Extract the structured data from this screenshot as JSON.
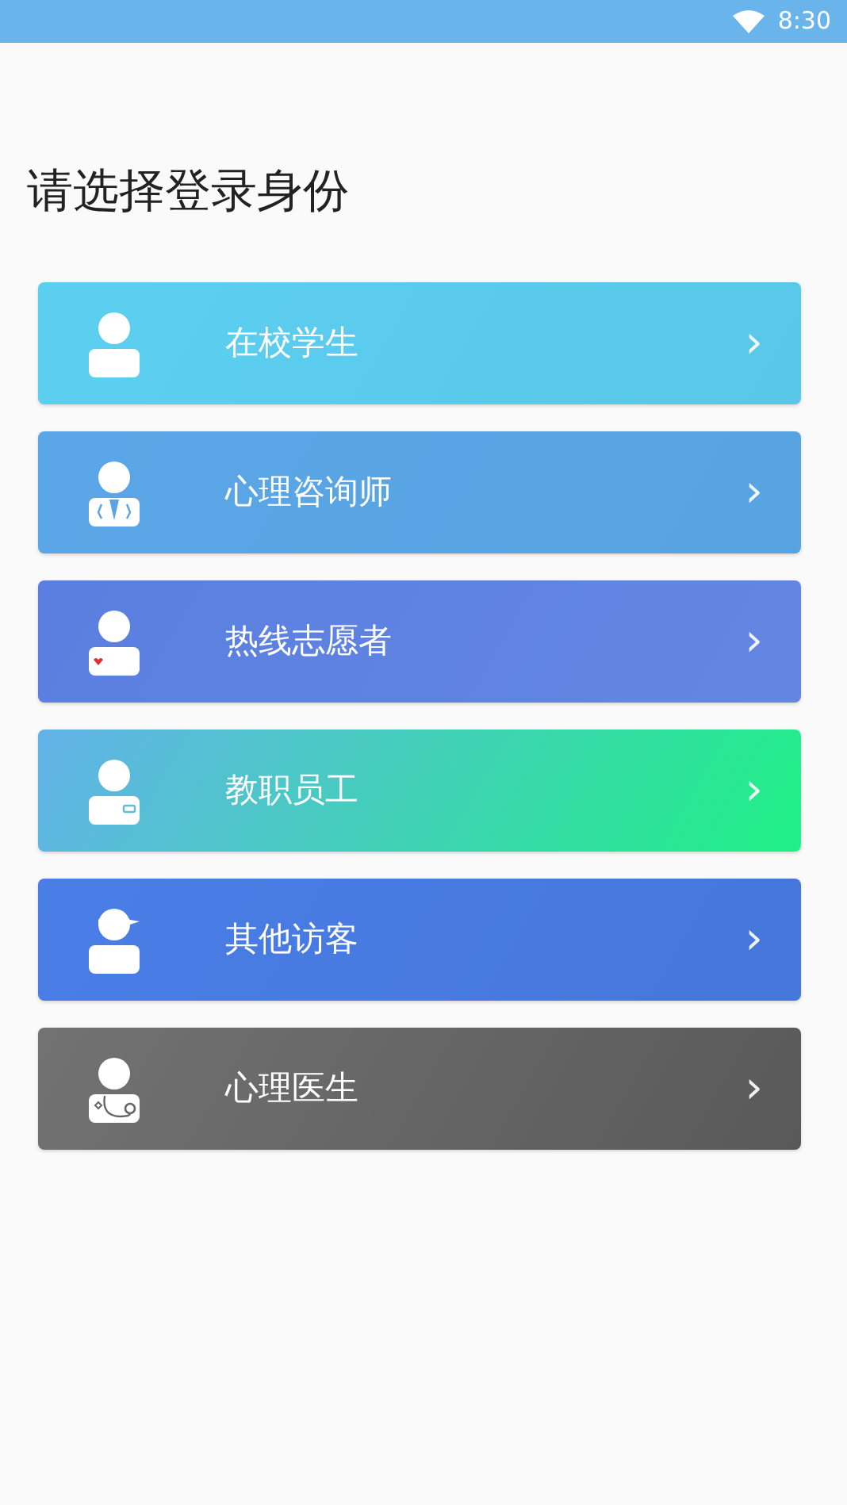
{
  "status_bar": {
    "time": "8:30"
  },
  "title": "请选择登录身份",
  "roles": [
    {
      "label": "在校学生",
      "kind": "student",
      "color": "#5ccff1",
      "chevron": "›"
    },
    {
      "label": "心理咨询师",
      "kind": "counselor",
      "color": "#5aa6e6",
      "chevron": "›"
    },
    {
      "label": "热线志愿者",
      "kind": "volunteer",
      "color": "#5a7fe0",
      "chevron": "›"
    },
    {
      "label": "教职员工",
      "kind": "staff",
      "color": "#63b2e8",
      "chevron": "›"
    },
    {
      "label": "其他访客",
      "kind": "visitor",
      "color": "#4a7ee7",
      "chevron": "›"
    },
    {
      "label": "心理医生",
      "kind": "doctor",
      "color": "#727272",
      "chevron": "›"
    }
  ]
}
